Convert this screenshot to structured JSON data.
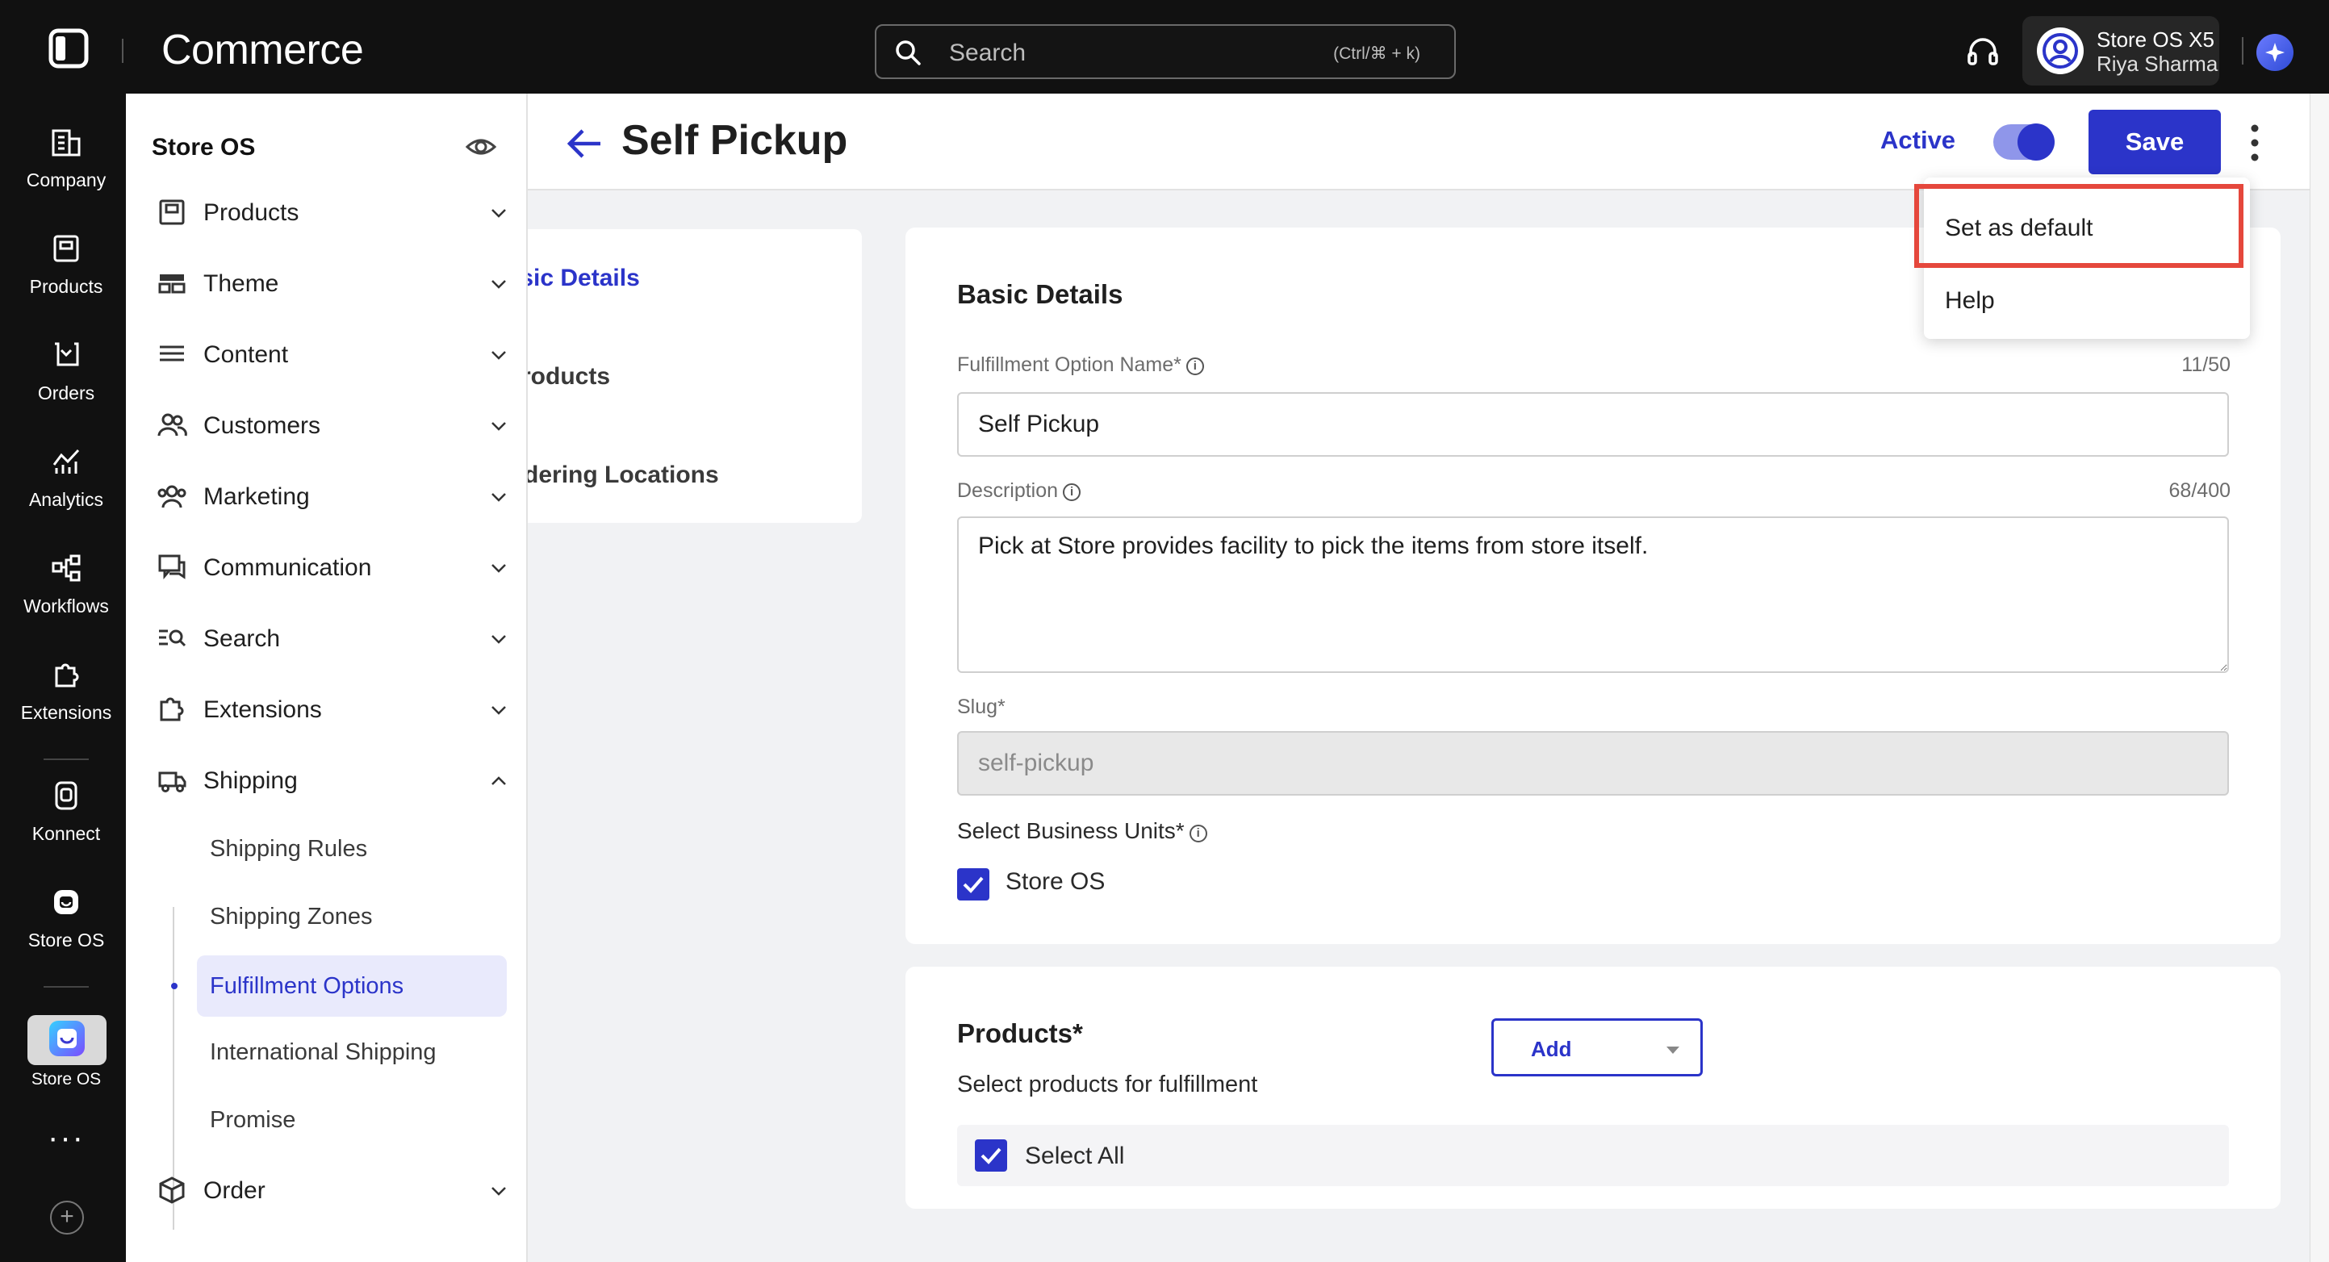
{
  "topbar": {
    "brand": "Commerce",
    "search_placeholder": "Search",
    "search_shortcut": "(Ctrl/⌘ + k)",
    "account_name": "Store OS X5",
    "user_name": "Riya Sharma"
  },
  "rail": {
    "items": [
      {
        "label": "Company",
        "icon": "building-icon"
      },
      {
        "label": "Products",
        "icon": "box-icon"
      },
      {
        "label": "Orders",
        "icon": "cart-icon"
      },
      {
        "label": "Analytics",
        "icon": "chart-icon"
      },
      {
        "label": "Workflows",
        "icon": "workflow-icon"
      },
      {
        "label": "Extensions",
        "icon": "puzzle-icon"
      },
      {
        "label": "Konnect",
        "icon": "konnect-icon"
      },
      {
        "label": "Store OS",
        "icon": "store-os-icon"
      },
      {
        "label": "Store OS",
        "icon": "store-os-app-icon"
      }
    ],
    "more": "···",
    "add": "+"
  },
  "sidemenu": {
    "title": "Store OS",
    "items": [
      {
        "label": "Products"
      },
      {
        "label": "Theme"
      },
      {
        "label": "Content"
      },
      {
        "label": "Customers"
      },
      {
        "label": "Marketing"
      },
      {
        "label": "Communication"
      },
      {
        "label": "Search"
      },
      {
        "label": "Extensions"
      },
      {
        "label": "Shipping"
      },
      {
        "label": "Order"
      }
    ],
    "shipping_sub": [
      {
        "label": "Shipping Rules"
      },
      {
        "label": "Shipping Zones"
      },
      {
        "label": "Fulfillment Options"
      },
      {
        "label": "International Shipping"
      },
      {
        "label": "Promise"
      }
    ]
  },
  "header": {
    "title": "Self Pickup",
    "status_label": "Active",
    "status_on": true,
    "save_label": "Save"
  },
  "menu": {
    "items": [
      {
        "label": "Set as default"
      },
      {
        "label": "Help"
      }
    ]
  },
  "section_nav": {
    "items": [
      {
        "label": "Basic Details"
      },
      {
        "label": "Products"
      },
      {
        "label": "Ordering Locations"
      }
    ]
  },
  "basic": {
    "heading": "Basic Details",
    "name_label": "Fulfillment Option Name*",
    "name_count": "11/50",
    "name_value": "Self Pickup",
    "desc_label": "Description",
    "desc_count": "68/400",
    "desc_value": "Pick at Store provides facility to pick the items from store itself.",
    "slug_label": "Slug*",
    "slug_value": "self-pickup",
    "bu_label": "Select Business Units*",
    "bu_option": "Store OS",
    "bu_checked": true
  },
  "products": {
    "heading": "Products*",
    "subtitle": "Select products for fulfillment",
    "add_label": "Add",
    "select_all_label": "Select All",
    "select_all_checked": true
  },
  "colors": {
    "accent": "#2b34c9",
    "highlight": "#e5473c",
    "topbar": "#111111"
  }
}
